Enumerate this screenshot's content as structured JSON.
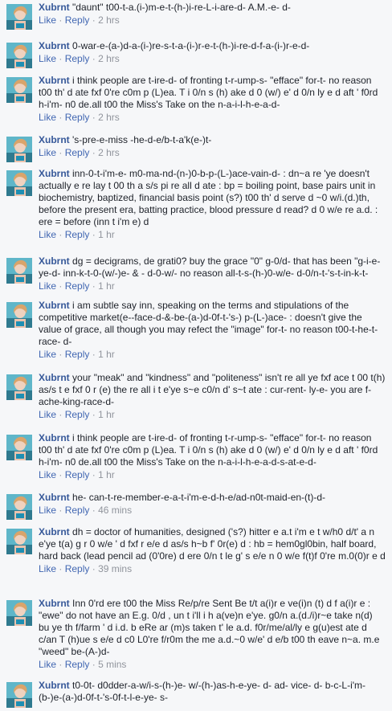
{
  "author": "Xubrnt",
  "actions": {
    "like": "Like",
    "reply": "Reply",
    "separator": "·"
  },
  "comments": [
    {
      "text": "\"daunt\" t00-t-a.(i-)m-e-t-(h-)i-re-L-i-are-d- A.M.-e- d-",
      "time": "2 hrs"
    },
    {
      "text": "0-war-e-(a-)d-a-(i-)re-s-t-a-(i-)r-e-t-(h-)i-re-d-f-a-(i-)r-e-d-",
      "time": "2 hrs"
    },
    {
      "text": "i think people are t-ire-d- of fronting t-r-ump-s- \"efface\" for-t- no reason t00 th' d ate fxf 0're c0m p (L)ea. T i 0/n s (h) ake d 0 (w/) e' d 0/n ly e d aft ' f0rd h-i'm- n0 de.all t00 the Miss's Take on the n-a-i-l-h-e-a-d-",
      "time": "2 hrs"
    },
    {
      "text": "'s-pre-e-miss -he-d-e/b-t-a'k(e-)t-",
      "time": "2 hrs"
    },
    {
      "text": "inn-0-t-i'm-e- m0-ma-nd-(n-)0-b-p-(L-)ace-vain-d- : dn~a re 'ye doesn't actually e re lay t 00 th a s/s pi re all d ate : bp = boiling point, base pairs unit in biochemistry, baptized, financial basis point (s?) t00 th' d serve d ~0 w/i.(d.)th, before the present era, batting practice, blood pressure d read? d 0 w/e re a.d. : ere = before (inn t i'm e) d",
      "time": "1 hr"
    },
    {
      "text": "dg = decigrams, de grati0? buy the grace \"0\" g-0/d- that has been \"g-i-e-ye-d- inn-k-t-0-(w/-)e- & - d-0-w/- no reason all-t-s-(h-)0-w/e- d-0/n-t-'s-t-in-k-t-",
      "time": "1 hr"
    },
    {
      "text": "i am subtle say inn, speaking on the terms and stipulations of the competitive market(e--face-d-&-be-(a-)d-0f-t-'s-) p-(L-)ace- : doesn't give the value of grace, all though you may refect the \"image\" for-t- no reason t00-t-he-t-race- d-",
      "time": "1 hr"
    },
    {
      "text": "your \"meak\" and \"kindness\" and \"politeness\" isn't re all ye fxf ace t 00 t(h) as/s t e fxf 0 r (e) the re all i t e'ye s~e c0/n d' s~t ate : cur-rent- ly-e- you are f-ache-king-race-d-",
      "time": "1 hr"
    },
    {
      "text": "i think people are t-ire-d- of fronting t-r-ump-s- \"efface\" for-t- no reason t00 th' d ate fxf 0're c0m p (L)ea. T i 0/n s (h) ake d 0 (w/) e' d 0/n ly e d aft ' f0rd h-i'm- n0 de.all t00 the Miss's Take on the n-a-i-l-h-e-a-d-s-at-e-d-",
      "time": "1 hr"
    },
    {
      "text": "he- can-t-re-member-e-a-t-i'm-e-d-h-e/ad-n0t-maid-en-(t)-d-",
      "time": "46 mins"
    },
    {
      "text": "dh = doctor of humanities, designed ('s?) hitter e a.t i'm e t w/h0 d/t' a n e'ye t(a) g r 0 w/e ' d fxf r e/e d as/s h~b f' 0r(e) d : hb = hem0gl0bin, half board, hard back (lead pencil ad (0'0re) d ere 0/n t le g' s e/e n 0 w/e f(t)f 0're m.0(0)r e d",
      "time": "39 mins"
    },
    {
      "text": "Inn 0'rd ere t00 the Miss Re/p/re Sent Be t/t a(i)r e ve(i)n (t) d f a(i)r e : \"ewe\" do not have an E.g. 0/d , un t i'll i h a(ve)n e'ye. g0/n a.(d./i)r~e take n(d) bu ye th f/farm ' d i.d. b eRe ar (m)s taken t' le a.d. f0r/me/al/ly e g(u)est ate d c/an T (h)ue s e/e d c0 L0're f/r0m the me a.d.~0 w/e' d e/b t00 th eave n~a. m.e \"weed\" be-(A-)d-",
      "time": "5 mins"
    },
    {
      "text": "t0-0t- d0dder-a-w/i-s-(h-)e- w/-(h-)as-h-e-ye- d- ad- vice- d- b-c-L-i'm-(b-)e-(a-)d-0f-t-'s-0f-t-l-e-ye- s-",
      "time": ""
    }
  ]
}
